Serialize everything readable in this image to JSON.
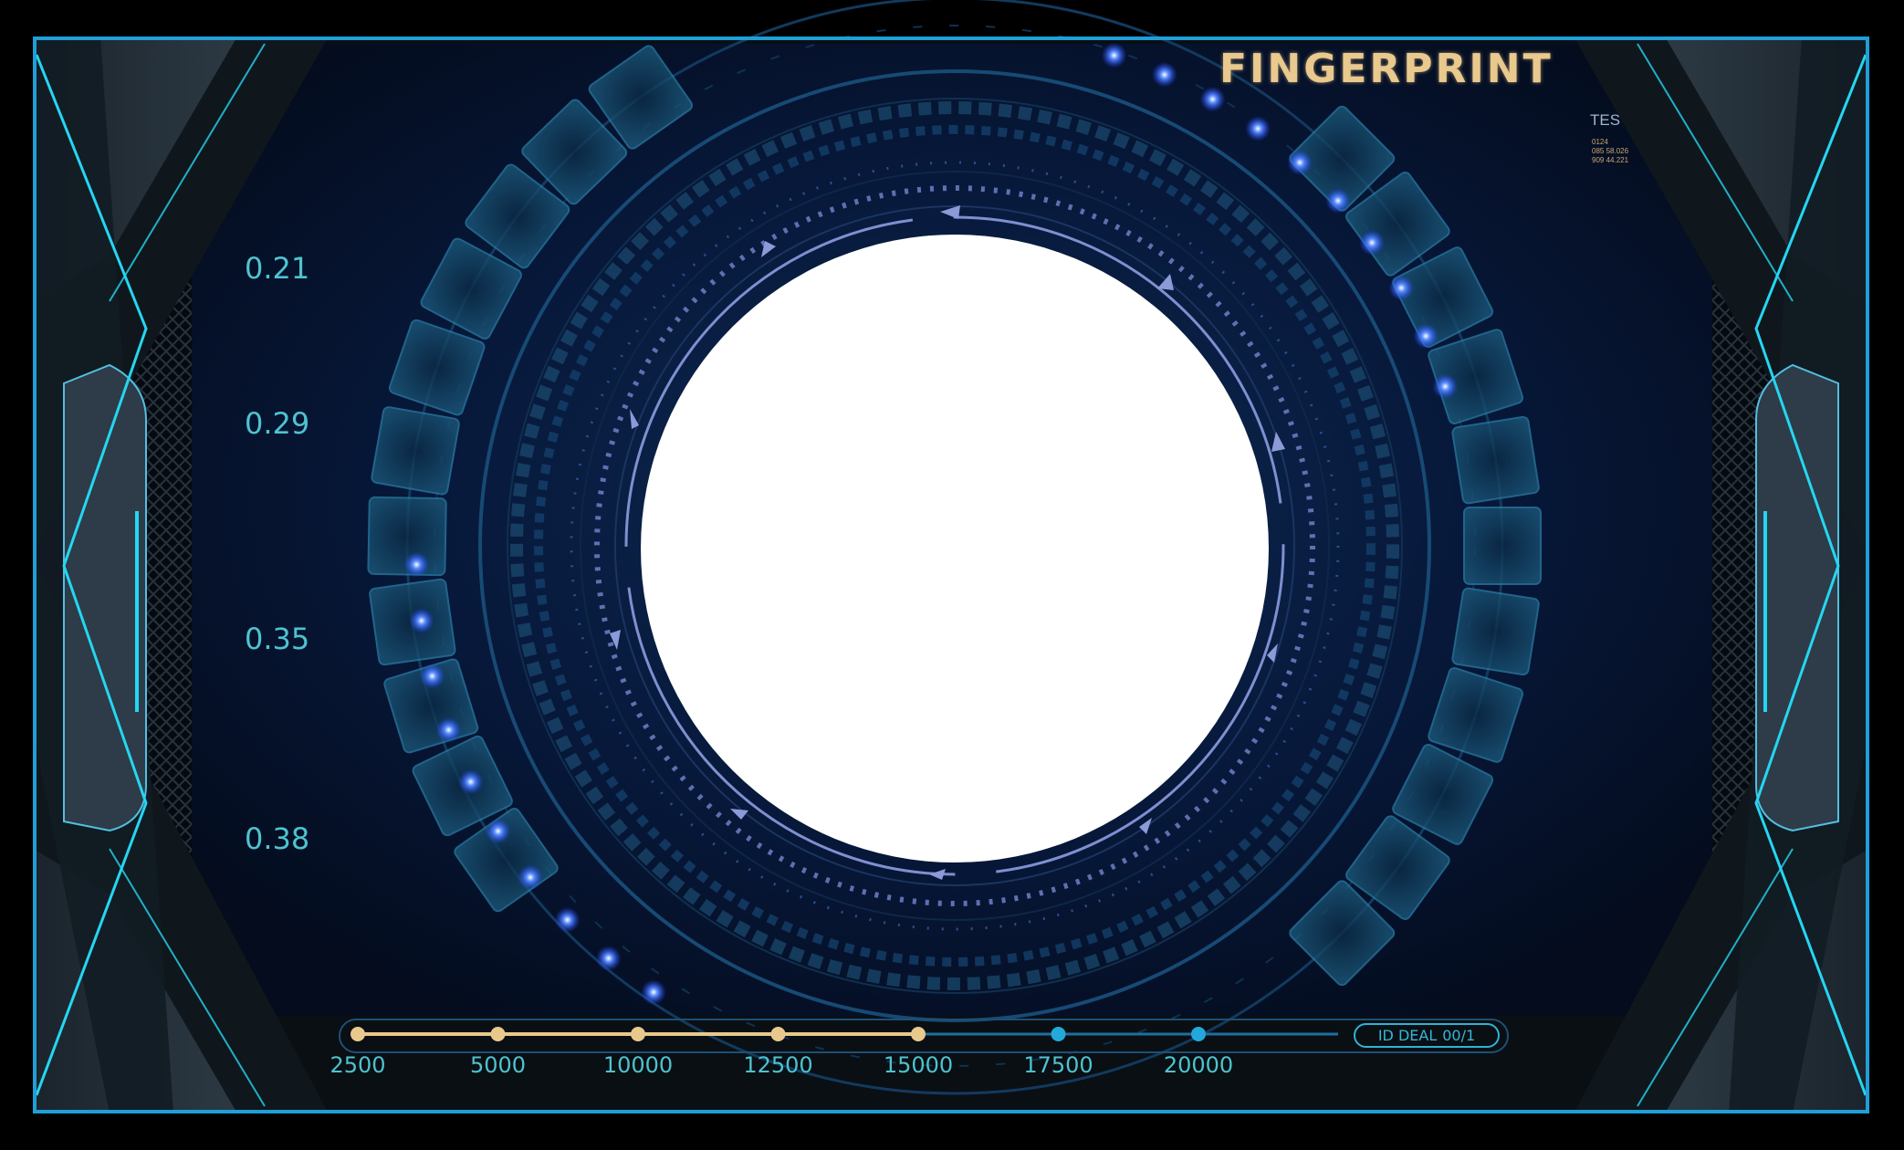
{
  "hud": {
    "title": "FINGERPRINT",
    "corner_tag": "TES",
    "corner_codes": [
      "0124",
      "085 58.026",
      "909 44.221"
    ]
  },
  "scale": {
    "labels": [
      "0.21",
      "0.29",
      "0.35",
      "0.38"
    ]
  },
  "progress": {
    "ticks": [
      "2500",
      "5000",
      "10000",
      "12500",
      "15000",
      "17500",
      "20000"
    ],
    "reached_count": 5,
    "status_label": "ID DEAL",
    "status_value": "00/1"
  },
  "colors": {
    "frame_border": "#1f9fd8",
    "accent_cyan": "#25d6f2",
    "title_gold": "#e9c98e",
    "reached_gold": "#e8c98c",
    "unreached_blue": "#23a9d9",
    "background_navy": "#06142b"
  }
}
